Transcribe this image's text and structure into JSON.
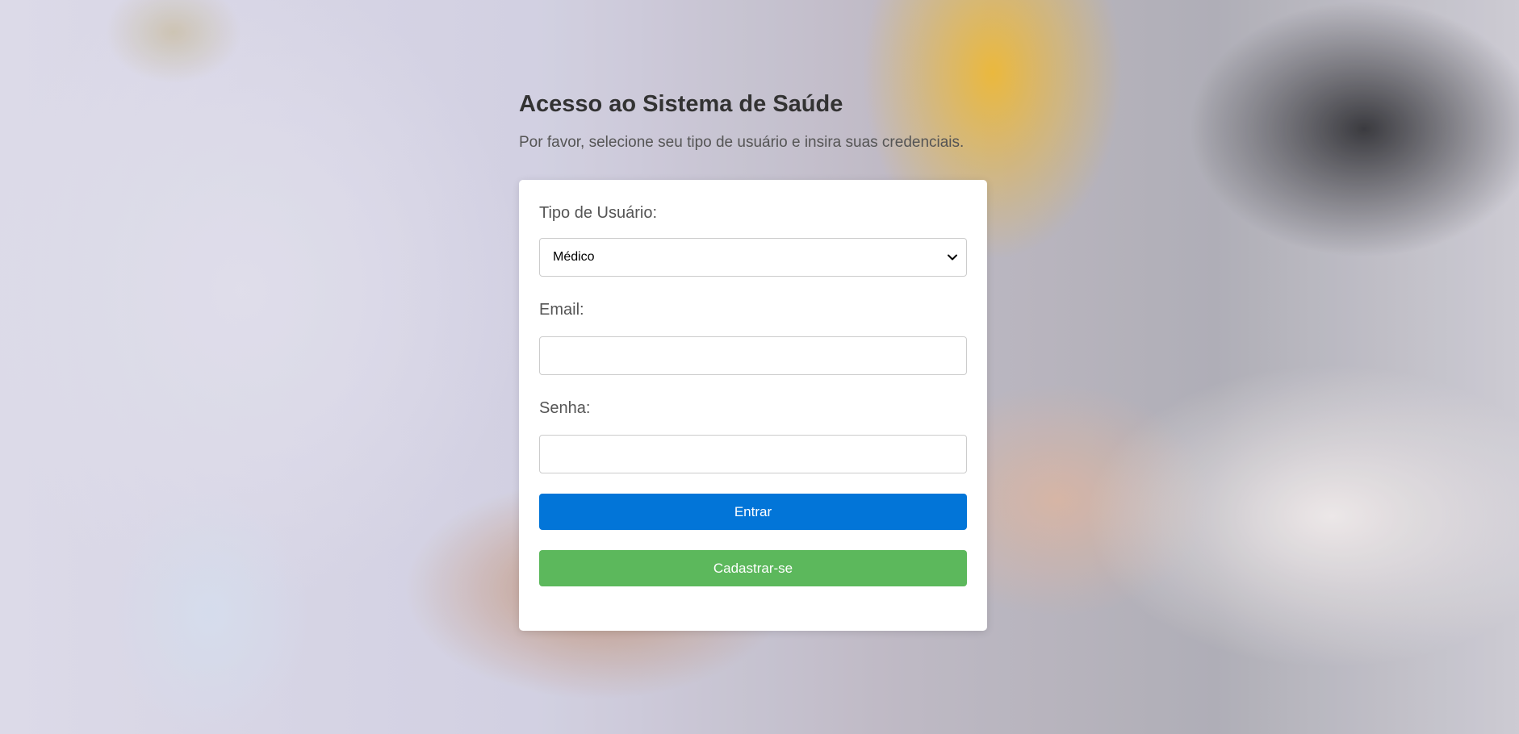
{
  "header": {
    "title": "Acesso ao Sistema de Saúde",
    "subtitle": "Por favor, selecione seu tipo de usuário e insira suas credenciais."
  },
  "form": {
    "user_type": {
      "label": "Tipo de Usuário:",
      "selected": "Médico",
      "icon": "chevron-down-icon"
    },
    "email": {
      "label": "Email:",
      "value": "",
      "placeholder": ""
    },
    "password": {
      "label": "Senha:",
      "value": "",
      "placeholder": ""
    },
    "submit_label": "Entrar",
    "register_label": "Cadastrar-se"
  },
  "colors": {
    "primary": "#0275d8",
    "success": "#5cb85c",
    "title_text": "#333333",
    "label_text": "#555555"
  }
}
